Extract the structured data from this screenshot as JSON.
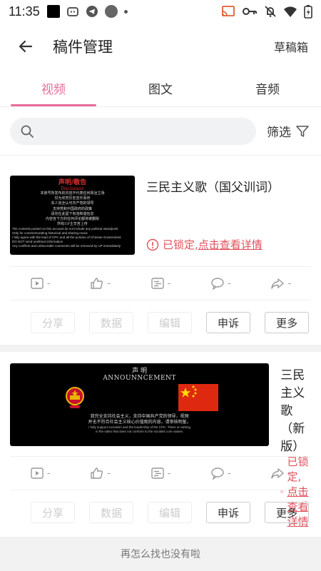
{
  "status_bar": {
    "time": "11:35"
  },
  "app_bar": {
    "title": "稿件管理",
    "drafts": "草稿箱"
  },
  "tabs": [
    {
      "label": "视频",
      "active": true
    },
    {
      "label": "图文",
      "active": false
    },
    {
      "label": "音频",
      "active": false
    }
  ],
  "search": {
    "placeholder": "",
    "filter_label": "筛选"
  },
  "cards": [
    {
      "title": "三民主义歌（国父训词）",
      "lock_prefix": "已锁定,",
      "lock_link": "点击查看详情",
      "stats": {
        "plays": "-",
        "likes": "-",
        "danmaku": "-",
        "comments": "-",
        "shares": "-"
      },
      "thumb": {
        "heading": "声明/敬告",
        "subheading": "Disclaimer",
        "lines": [
          "本账号所发布的内容不代表任何政治立场",
          "仅为欣赏历史音乐而存",
          "本人完全认可共产党的领导",
          "支持党和中国政府的政策",
          "请勿在此留下有违和谐信息",
          "内容含下方的任何评论都将被删除",
          "所有UP主辛苦上传"
        ],
        "en_lines": [
          "The contents posted on this account do not include any political standpoint",
          "Only for commemorating historical and sharing music",
          "I fully agree with the lead of CPC and all the policies of Chinese Government",
          "DO NOT send unethical information",
          "Any conflicts and unfavorable comments will be removed by UP immediately"
        ]
      }
    },
    {
      "title": "三民主义歌（新版）",
      "lock_prefix": "已锁定,",
      "lock_link": "点击查看详情",
      "stats": {
        "plays": "-",
        "likes": "-",
        "danmaku": "-",
        "comments": "-",
        "shares": "-"
      },
      "thumb": {
        "heading": "声 明",
        "subheading": "ANNOUNNCEMENT",
        "zh_lines": [
          "我完全支持社会主义，支持中国共产党的领导，视频",
          "并无不符合社会主义核心价值观的内容，请审核明鉴。"
        ],
        "en_lines": [
          "I fully support socialism and the leadership of the CPC. There is nothing",
          "in the video that does not conform to the socialist core values."
        ]
      }
    }
  ],
  "actions": {
    "share": "分享",
    "data": "数据",
    "edit": "编辑",
    "appeal": "申诉",
    "more": "更多"
  },
  "footer": "再怎么找也没有啦",
  "colors": {
    "accent": "#e86b9a",
    "lock": "#e0505b"
  }
}
